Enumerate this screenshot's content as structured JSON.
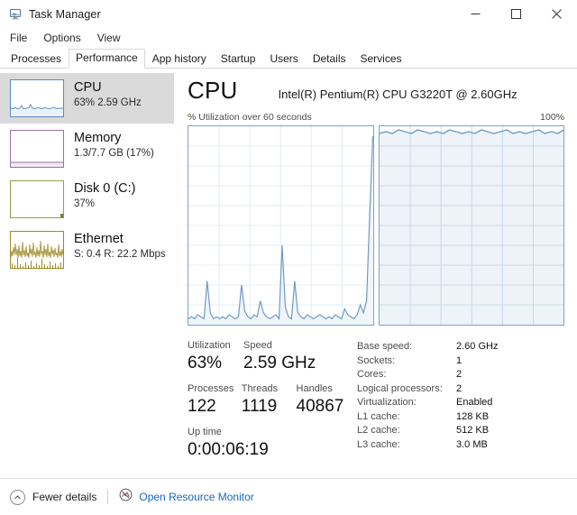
{
  "window": {
    "title": "Task Manager",
    "app_icon": "task-manager-icon",
    "controls": {
      "minimize": "minimize-icon",
      "maximize": "maximize-icon",
      "close": "close-icon"
    }
  },
  "menu": {
    "items": [
      {
        "label": "File"
      },
      {
        "label": "Options"
      },
      {
        "label": "View"
      }
    ]
  },
  "tabs": {
    "active": "Performance",
    "items": [
      {
        "label": "Processes"
      },
      {
        "label": "Performance"
      },
      {
        "label": "App history"
      },
      {
        "label": "Startup"
      },
      {
        "label": "Users"
      },
      {
        "label": "Details"
      },
      {
        "label": "Services"
      }
    ]
  },
  "sidebar": {
    "items": [
      {
        "name": "CPU",
        "title": "CPU",
        "subtitle": "63%  2.59 GHz",
        "selected": true,
        "color": "#5a8cc0"
      },
      {
        "name": "Memory",
        "title": "Memory",
        "subtitle": "1.3/7.7 GB (17%)",
        "selected": false,
        "color": "#9d6fa8"
      },
      {
        "name": "Disk 0 (C:)",
        "title": "Disk 0 (C:)",
        "subtitle": "37%",
        "selected": false,
        "color": "#8ba04a"
      },
      {
        "name": "Ethernet",
        "title": "Ethernet",
        "subtitle": "S: 0.4 R: 22.2 Mbps",
        "selected": false,
        "color": "#a08a24"
      }
    ]
  },
  "main": {
    "title": "CPU",
    "model": "Intel(R) Pentium(R) CPU G3220T @ 2.60GHz",
    "graph_caption_left": "% Utilization over 60 seconds",
    "graph_caption_right": "100%",
    "stats": {
      "utilization": {
        "label": "Utilization",
        "value": "63%"
      },
      "speed": {
        "label": "Speed",
        "value": "2.59 GHz"
      },
      "processes": {
        "label": "Processes",
        "value": "122"
      },
      "threads": {
        "label": "Threads",
        "value": "1119"
      },
      "handles": {
        "label": "Handles",
        "value": "40867"
      },
      "uptime": {
        "label": "Up time",
        "value": "0:00:06:19"
      }
    },
    "specs": [
      {
        "label": "Base speed:",
        "value": "2.60 GHz"
      },
      {
        "label": "Sockets:",
        "value": "1"
      },
      {
        "label": "Cores:",
        "value": "2"
      },
      {
        "label": "Logical processors:",
        "value": "2"
      },
      {
        "label": "Virtualization:",
        "value": "Enabled"
      },
      {
        "label": "L1 cache:",
        "value": "128 KB"
      },
      {
        "label": "L2 cache:",
        "value": "512 KB"
      },
      {
        "label": "L3 cache:",
        "value": "3.0 MB"
      }
    ]
  },
  "footer": {
    "fewer_details_label": "Fewer details",
    "fewer_details_icon": "chevron-up-icon",
    "resource_monitor_label": "Open Resource Monitor",
    "resource_monitor_icon": "resource-monitor-icon",
    "link_color": "#1667c4"
  },
  "chart_data": [
    {
      "type": "line",
      "name": "cpu-utilization-history",
      "title": "% Utilization over 60 seconds",
      "xlabel": "60 seconds",
      "ylabel": "% Utilization",
      "ylim": [
        0,
        100
      ],
      "xlim": [
        0,
        60
      ],
      "grid": true,
      "legend": "none",
      "line_color": "#5a8cc0",
      "fill_color": "#eaf1f8",
      "values": [
        3,
        4,
        3,
        5,
        4,
        3,
        22,
        6,
        3,
        4,
        3,
        4,
        3,
        5,
        4,
        3,
        4,
        20,
        7,
        4,
        3,
        5,
        4,
        12,
        6,
        4,
        3,
        4,
        5,
        3,
        40,
        9,
        4,
        3,
        22,
        6,
        4,
        3,
        5,
        4,
        3,
        4,
        5,
        4,
        3,
        4,
        3,
        5,
        4,
        3,
        8,
        5,
        4,
        3,
        5,
        10,
        6,
        12,
        55,
        95
      ]
    },
    {
      "type": "area",
      "name": "cpu-utilization-current-detail",
      "ylim": [
        0,
        100
      ],
      "grid": true,
      "legend": "none",
      "line_color": "#5a8cc0",
      "fill_color": "#eef3f9",
      "values": [
        96,
        97,
        96,
        98,
        97,
        96,
        97,
        98,
        96,
        97,
        96,
        98,
        97,
        96,
        97,
        96,
        98,
        97,
        96,
        97,
        98,
        96,
        97,
        96,
        97,
        98,
        96,
        97,
        96,
        98
      ]
    }
  ]
}
